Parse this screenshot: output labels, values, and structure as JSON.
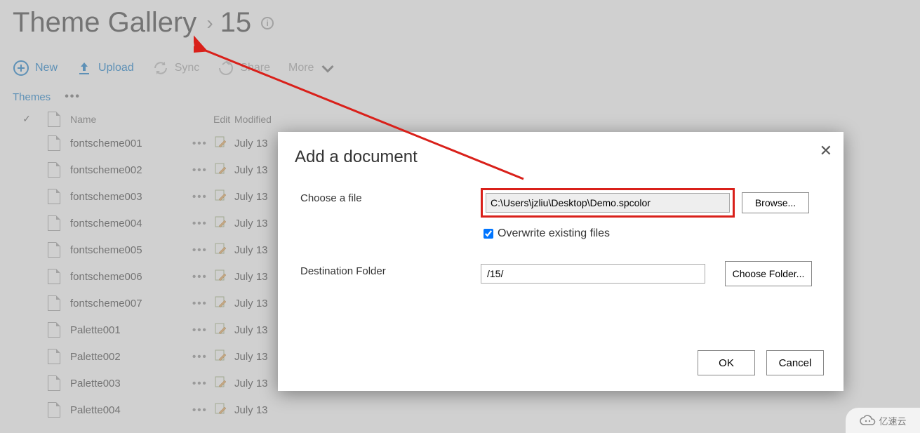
{
  "header": {
    "title_main": "Theme Gallery",
    "title_sub": "15"
  },
  "toolbar": {
    "new_label": "New",
    "upload_label": "Upload",
    "sync_label": "Sync",
    "share_label": "Share",
    "more_label": "More"
  },
  "subnav": {
    "tab_themes": "Themes"
  },
  "list": {
    "header_name": "Name",
    "header_edit": "Edit",
    "header_modified": "Modified",
    "rows": [
      {
        "name": "fontscheme001",
        "modified": "July 13"
      },
      {
        "name": "fontscheme002",
        "modified": "July 13"
      },
      {
        "name": "fontscheme003",
        "modified": "July 13"
      },
      {
        "name": "fontscheme004",
        "modified": "July 13"
      },
      {
        "name": "fontscheme005",
        "modified": "July 13"
      },
      {
        "name": "fontscheme006",
        "modified": "July 13"
      },
      {
        "name": "fontscheme007",
        "modified": "July 13"
      },
      {
        "name": "Palette001",
        "modified": "July 13"
      },
      {
        "name": "Palette002",
        "modified": "July 13"
      },
      {
        "name": "Palette003",
        "modified": "July 13"
      },
      {
        "name": "Palette004",
        "modified": "July 13"
      }
    ]
  },
  "dialog": {
    "title": "Add a document",
    "choose_label": "Choose a file",
    "file_value": "C:\\Users\\jzliu\\Desktop\\Demo.spcolor",
    "browse_label": "Browse...",
    "overwrite_label": "Overwrite existing files",
    "overwrite_checked": true,
    "dest_label": "Destination Folder",
    "dest_value": "/15/",
    "choose_folder_label": "Choose Folder...",
    "ok_label": "OK",
    "cancel_label": "Cancel"
  },
  "watermark": {
    "text": "亿速云"
  },
  "colors": {
    "accent": "#0072c6",
    "annotation": "#d9201a"
  }
}
